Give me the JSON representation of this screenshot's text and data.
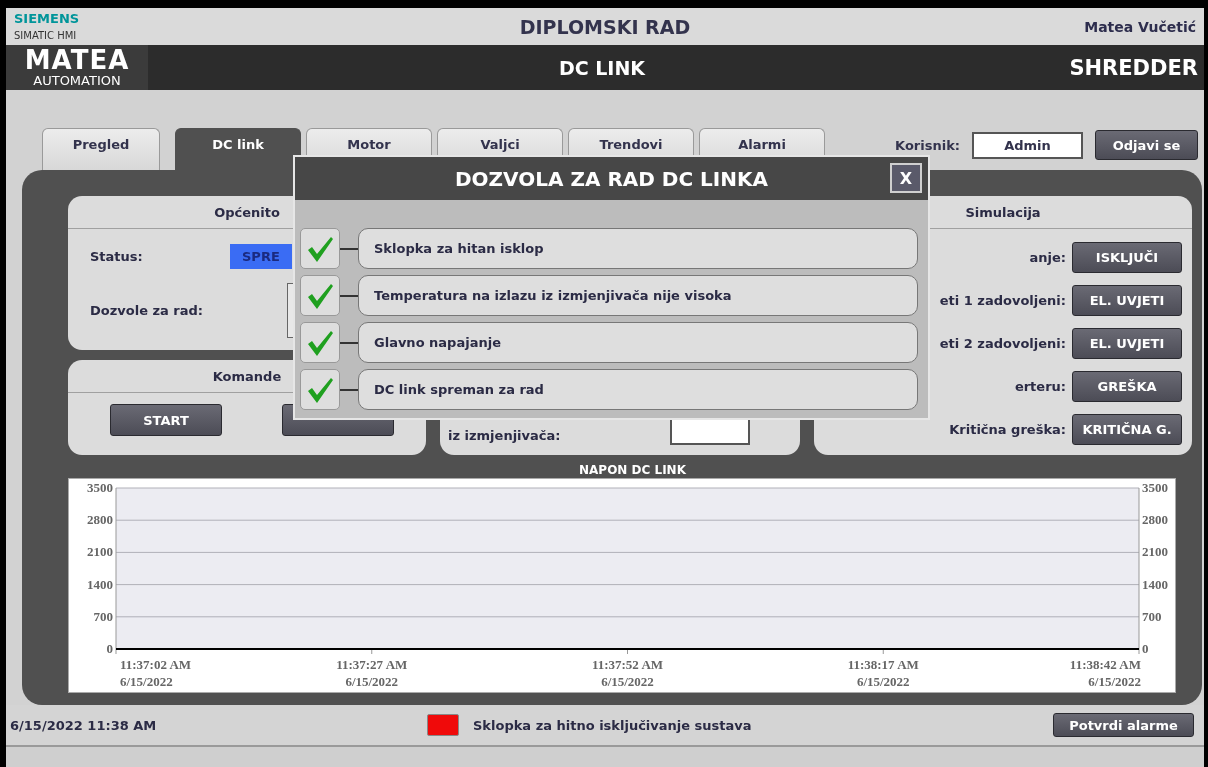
{
  "header": {
    "brand": "SIEMENS",
    "product": "SIMATIC HMI",
    "title": "DIPLOMSKI RAD",
    "author": "Matea Vučetić"
  },
  "banner": {
    "logo": "MATEA",
    "logo_subtitle": "AUTOMATION",
    "screen": "DC LINK",
    "machine": "SHREDDER"
  },
  "tabs": [
    {
      "label": "Pregled",
      "selected": false
    },
    {
      "label": "DC link",
      "selected": true
    },
    {
      "label": "Motor",
      "selected": false
    },
    {
      "label": "Valjci",
      "selected": false
    },
    {
      "label": "Trendovi",
      "selected": false
    },
    {
      "label": "Alarmi",
      "selected": false
    }
  ],
  "user": {
    "label": "Korisnik:",
    "value": "Admin",
    "logout": "Odjavi se"
  },
  "general": {
    "title": "Općenito",
    "status_label": "Status:",
    "status_value": "SPRE",
    "permissions_label": "Dozvole za rad:"
  },
  "commands": {
    "title": "Komande",
    "start": "START"
  },
  "temperature": {
    "label": "iz izmjenjivača:"
  },
  "simulation": {
    "title": "Simulacija",
    "rows": [
      {
        "label": "anje:",
        "button": "ISKLJUČI"
      },
      {
        "label": "eti 1 zadovoljeni:",
        "button": "EL. UVJETI"
      },
      {
        "label": "eti 2 zadovoljeni:",
        "button": "EL. UVJETI"
      },
      {
        "label": "erteru:",
        "button": "GREŠKA"
      },
      {
        "label": "Kritična greška:",
        "button": "KRITIČNA G."
      }
    ]
  },
  "chart": {
    "chart_data": {
      "type": "line",
      "title": "NAPON DC LINK",
      "categories": [
        "11:37:02 AM\n6/15/2022",
        "11:37:27 AM\n6/15/2022",
        "11:37:52 AM\n6/15/2022",
        "11:38:17 AM\n6/15/2022",
        "11:38:42 AM\n6/15/2022"
      ],
      "ylim": [
        0,
        3500
      ],
      "yticks": [
        0,
        700,
        1400,
        2100,
        2800,
        3500
      ],
      "y2ticks": [
        0,
        700,
        1400,
        2100,
        2800,
        3500
      ],
      "y2lim": [
        0,
        3500
      ],
      "grid": true,
      "series": [
        {
          "color": "#000000",
          "values": [
            0,
            0,
            0,
            0,
            0
          ]
        }
      ]
    }
  },
  "dialog": {
    "title": "DOZVOLA ZA RAD DC LINKA",
    "close": "X",
    "items": [
      {
        "label": "Sklopka za hitan isklop",
        "checked": true
      },
      {
        "label": "Temperatura na izlazu iz izmjenjivača nije visoka",
        "checked": true
      },
      {
        "label": "Glavno napajanje",
        "checked": true
      },
      {
        "label": "DC link spreman za rad",
        "checked": true
      }
    ]
  },
  "status_bar": {
    "datetime": "6/15/2022 11:38 AM",
    "alarm": {
      "text": "Sklopka za hitno isključivanje sustava",
      "active": true
    },
    "acknowledge": "Potvrdi alarme"
  }
}
